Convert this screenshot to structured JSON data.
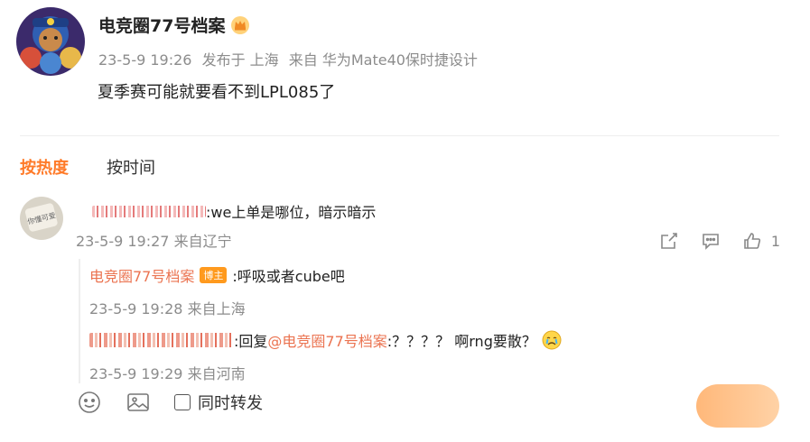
{
  "post": {
    "author_name": "电竞圈77号档案",
    "date": "23-5-9 19:26",
    "published_in": "发布于 上海",
    "source": "来自 华为Mate40保时捷设计",
    "text": "夏季赛可能就要看不到LPL085了"
  },
  "sort_tabs": [
    {
      "label": "按热度",
      "active": true
    },
    {
      "label": "按时间",
      "active": false
    }
  ],
  "comment": {
    "text": ":we上单是哪位，暗示暗示",
    "date": "23-5-9 19:27",
    "location": "来自辽宁",
    "like_count": "1",
    "avatar_text": "你懂 可爱"
  },
  "replies": [
    {
      "author": "电竞圈77号档案",
      "badge": "博主",
      "text": ":呼吸或者cube吧",
      "date": "23-5-9 19:28",
      "location": "来自上海"
    },
    {
      "prefix": ":回复",
      "mention": "@电竞圈77号档案",
      "text": ":？？？？ 啊rng要散？",
      "emoji": "crying-emoji",
      "date": "23-5-9 19:29",
      "location": "来自河南"
    }
  ],
  "composer": {
    "repost_label": "同时转发",
    "icons": [
      "emoji-icon",
      "image-icon"
    ]
  },
  "colors": {
    "accent": "#ff7a28",
    "link": "#eb7350",
    "muted": "#8c8c8c",
    "badge": "#ff9a1e"
  }
}
